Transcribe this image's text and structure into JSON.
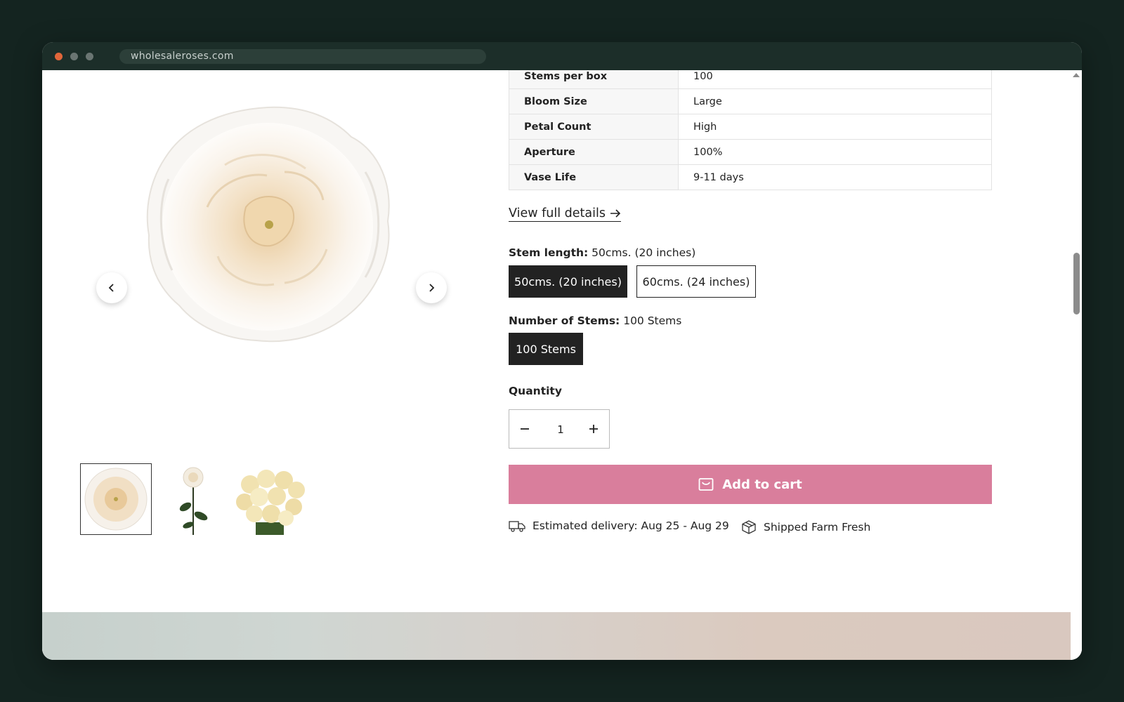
{
  "browser": {
    "url": "wholesaleroses.com"
  },
  "specs": [
    {
      "label": "Stems per box",
      "value": "100"
    },
    {
      "label": "Bloom Size",
      "value": "Large"
    },
    {
      "label": "Petal Count",
      "value": "High"
    },
    {
      "label": "Aperture",
      "value": "100%"
    },
    {
      "label": "Vase Life",
      "value": "9-11 days"
    }
  ],
  "view_full_details": "View full details",
  "stem_length": {
    "label": "Stem length:",
    "selected": "50cms. (20 inches)",
    "options": [
      "50cms. (20 inches)",
      "60cms. (24 inches)"
    ]
  },
  "number_of_stems": {
    "label": "Number of Stems:",
    "selected": "100 Stems",
    "options": [
      "100 Stems"
    ]
  },
  "quantity": {
    "label": "Quantity",
    "value": "1"
  },
  "add_to_cart": "Add to cart",
  "delivery": "Estimated delivery: Aug 25 - Aug 29",
  "shipping": "Shipped Farm Fresh",
  "colors": {
    "accent": "#d97e9c",
    "selected_option": "#222222"
  }
}
